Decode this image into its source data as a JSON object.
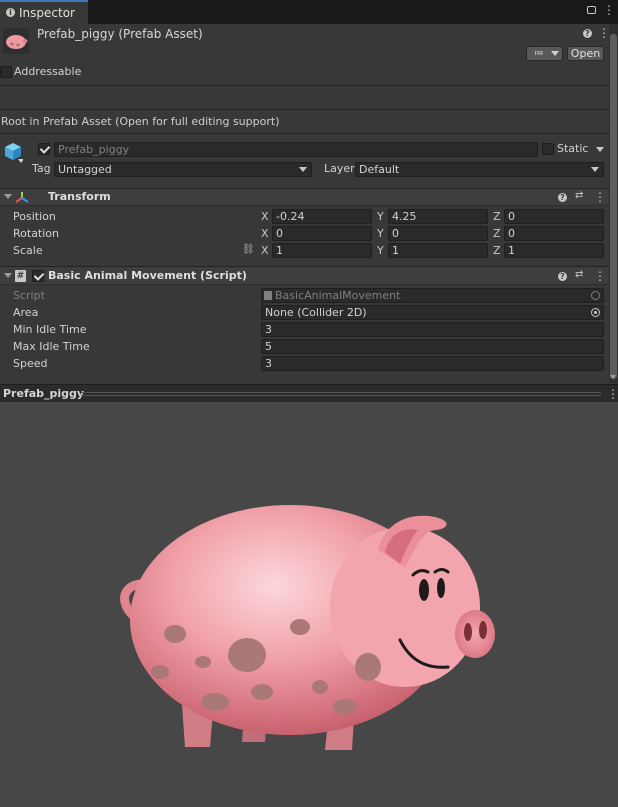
{
  "tab": {
    "label": "Inspector",
    "icon": "info-icon"
  },
  "asset": {
    "title": "Prefab_piggy (Prefab Asset)",
    "open_label": "Open"
  },
  "addressable": {
    "label": "Addressable",
    "checked": false
  },
  "root_notice": "Root in Prefab Asset (Open for full editing support)",
  "gameobject": {
    "name": "Prefab_piggy",
    "active": true,
    "static_label": "Static",
    "tag_label": "Tag",
    "tag_value": "Untagged",
    "layer_label": "Layer",
    "layer_value": "Default"
  },
  "transform": {
    "title": "Transform",
    "position": {
      "label": "Position",
      "x": "-0.24",
      "y": "4.25",
      "z": "0"
    },
    "rotation": {
      "label": "Rotation",
      "x": "0",
      "y": "0",
      "z": "0"
    },
    "scale": {
      "label": "Scale",
      "x": "1",
      "y": "1",
      "z": "1"
    },
    "axis": {
      "x": "X",
      "y": "Y",
      "z": "Z"
    }
  },
  "movement": {
    "title": "Basic Animal Movement (Script)",
    "enabled": true,
    "script_label": "Script",
    "script_value": "BasicAnimalMovement",
    "area_label": "Area",
    "area_value": "None (Collider 2D)",
    "min_idle_label": "Min Idle Time",
    "min_idle_value": "3",
    "max_idle_label": "Max Idle Time",
    "max_idle_value": "5",
    "speed_label": "Speed",
    "speed_value": "3"
  },
  "preview": {
    "title": "Prefab_piggy"
  },
  "colors": {
    "background": "#383838",
    "field": "#2a2a2a",
    "preview_bg": "#474747",
    "pig_pink": "#f19aa3",
    "pig_spots": "#a97877"
  }
}
